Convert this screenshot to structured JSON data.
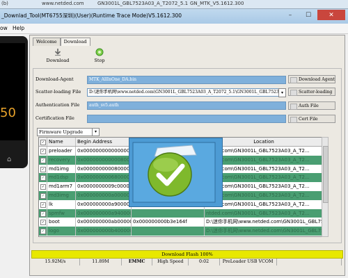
{
  "browser": {
    "left_text": "(b)",
    "url": "www.netded.com",
    "title_part": "GN3001L_GBL7523A03_A_T2072_5.1",
    "folder": "GN_MTK_V5.1612.300"
  },
  "window": {
    "title": "_Downlad_Tool(MT6755深圳)(User)(Runtime Trace Mode)V5.1612.300",
    "minimize": "–",
    "maximize": "☐",
    "close": "✕"
  },
  "menu": {
    "view": "ow",
    "help": "Help"
  },
  "phone": {
    "number": "50",
    "nav": "⌂"
  },
  "tabs": [
    {
      "label": "Welcome"
    },
    {
      "label": "Download"
    }
  ],
  "toolbar": {
    "download": "Download",
    "stop": "Stop"
  },
  "form": {
    "download_agent": {
      "label": "Download-Agent",
      "value": "MTK_AllInOne_DA.bin",
      "button": "Download Agent"
    },
    "scatter": {
      "label": "Scatter-loading File",
      "value": "D:\\迷你手机网\\www.netded.com\\GN3001L_GBL7523A03_A_T2072_5.1\\GN3001L_GBL7523A03_A_T2",
      "button": "Scatter-loading"
    },
    "auth": {
      "label": "Authentication File",
      "value": "auth_sv5.auth",
      "button": "Auth File"
    },
    "cert": {
      "label": "Certification File",
      "value": "",
      "button": "Cert File"
    }
  },
  "mode_select": {
    "value": "Firmware Upgrade"
  },
  "table": {
    "headers": [
      "",
      "Name",
      "Begin Address",
      "",
      "Location"
    ],
    "rows": [
      {
        "name": "preloader",
        "begin": "0x0000000000000000",
        "end": "",
        "location": "ntded.com\\GN3001L_GBL7523A03_A_T2...",
        "checked": true
      },
      {
        "name": "recovery",
        "begin": "0x0000000000008000",
        "end": "",
        "location": "ntded.com\\GN3001L_GBL7523A03_A_T2...",
        "checked": true
      },
      {
        "name": "md1img",
        "begin": "0x0000000000800000",
        "end": "",
        "location": "ntded.com\\GN3001L_GBL7523A03_A_T2...",
        "checked": true
      },
      {
        "name": "md1dsp",
        "begin": "0x0000000006800000",
        "end": "",
        "location": "ntded.com\\GN3001L_GBL7523A03_A_T2...",
        "checked": true
      },
      {
        "name": "md1arm7",
        "begin": "0x0000000009c00000",
        "end": "",
        "location": "ntded.com\\GN3001L_GBL7523A03_A_T2...",
        "checked": true
      },
      {
        "name": "md3img",
        "begin": "0x000000000a000000",
        "end": "",
        "location": "ntded.com\\GN3001L_GBL7523A03_A_T2...",
        "checked": true
      },
      {
        "name": "lk",
        "begin": "0x000000000a900000",
        "end": "",
        "location": "ntded.com\\GN3001L_GBL7523A03_A_T2...",
        "checked": true
      },
      {
        "name": "spmfw",
        "begin": "0x000000000a940000",
        "end": "",
        "location": "ntded.com\\GN3001L_GBL7523A03_A_T2...",
        "checked": true
      },
      {
        "name": "boot",
        "begin": "0x000000000ab00000",
        "end": "0x000000000b3e164f",
        "location": "D:\\迷你手机网\\www.netded.com\\GN3001L_GBL7523A03_A_T2...",
        "checked": true
      },
      {
        "name": "logo",
        "begin": "0x000000000b400000",
        "end": "",
        "location": "D:\\迷你手机网\\www.netded.com\\GN3001L_GBL7523A03_A_T2...",
        "checked": true
      }
    ]
  },
  "progress": {
    "label": "Download Flash 100%",
    "value": 1.0
  },
  "status": [
    "15.92M/s",
    "11.89M",
    "EMMC",
    "High Speed",
    "0:02",
    "PreLoader USB VCOM",
    ""
  ],
  "colors": {
    "progress": "#e8e800",
    "row_alt": "#4a9e72",
    "field": "#7fb0db",
    "dialog": "#4d9bd4",
    "success": "#7fb92c"
  }
}
